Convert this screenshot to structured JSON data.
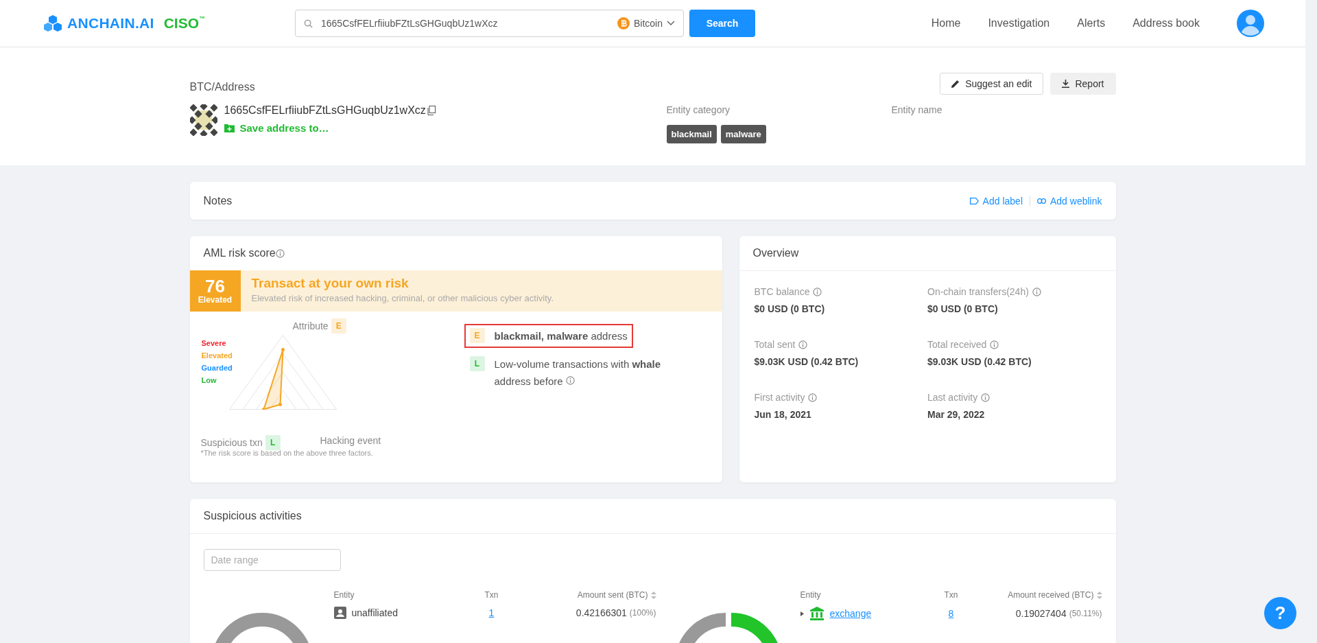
{
  "header": {
    "logo": "ANCHAIN.AI",
    "product": "CISO",
    "trademark": "™",
    "search": {
      "value": "1665CsfFELrfiiubFZtLsGHGuqbUz1wXcz",
      "currency": "Bitcoin",
      "button": "Search"
    },
    "nav": [
      "Home",
      "Investigation",
      "Alerts",
      "Address book"
    ]
  },
  "address": {
    "breadcrumb": "BTC/Address",
    "buttons": [
      {
        "kind": "edit",
        "label": "Suggest an edit"
      },
      {
        "kind": "report",
        "label": "Report"
      }
    ],
    "address": "1665CsfFELrfiiubFZtLsGHGuqbUz1wXcz",
    "save_link": "Save address to…",
    "entity_category_label": "Entity category",
    "tags": [
      "blackmail",
      "malware"
    ],
    "entity_name_label": "Entity name"
  },
  "notes": {
    "title": "Notes",
    "actions": [
      {
        "kind": "label",
        "label": "Add label"
      },
      {
        "kind": "weblink",
        "label": "Add weblink"
      }
    ]
  },
  "aml": {
    "title": "AML risk score",
    "score": "76",
    "score_label": "Elevated",
    "kind": "elevated",
    "headline": "Transact at your own risk",
    "description": "Elevated risk of increased hacking, criminal, or other malicious cyber activity.",
    "radar": {
      "axes": [
        {
          "label": "Attribute",
          "badge": "E",
          "kind": "elevated"
        },
        {
          "label": "Suspicious txn",
          "badge": "L",
          "kind": "low"
        },
        {
          "label": "Hacking event"
        }
      ],
      "levels": [
        {
          "label": "Severe",
          "color": "#f5222d"
        },
        {
          "label": "Elevated",
          "color": "#f5a623"
        },
        {
          "label": "Guarded",
          "color": "#1890ff"
        },
        {
          "label": "Low",
          "color": "#22bb33"
        }
      ]
    },
    "factors": [
      {
        "badge": "E",
        "kind": "elevated",
        "text": "**blackmail, malware** address",
        "highlighted": true,
        "info": false
      },
      {
        "badge": "L",
        "kind": "low",
        "text": "Low-volume transactions with **whale** address before",
        "highlighted": false,
        "info": true
      }
    ],
    "footnote": "*The risk score is based on the above three factors."
  },
  "overview": {
    "title": "Overview",
    "items": [
      {
        "label": "BTC balance",
        "value": "$0 USD (0 BTC)"
      },
      {
        "label": "On-chain transfers(24h)",
        "value": "$0 USD (0 BTC)"
      },
      {
        "label": "Total sent",
        "value": "$9.03K USD (0.42 BTC)"
      },
      {
        "label": "Total received",
        "value": "$9.03K USD (0.42 BTC)"
      },
      {
        "label": "First activity",
        "value": "Jun 18, 2021"
      },
      {
        "label": "Last activity",
        "value": "Mar 29, 2022"
      }
    ]
  },
  "suspicious": {
    "title": "Suspicious activities",
    "date_placeholder": "Date range",
    "tables": [
      {
        "columns": [
          "Entity",
          "Txn",
          "Amount sent (BTC)"
        ],
        "rows": [
          {
            "kind": "person",
            "expandable": false,
            "entity": "unaffiliated",
            "link": false,
            "txn": "1",
            "amount": "0.42166301",
            "share": "(100%)"
          }
        ]
      },
      {
        "columns": [
          "Entity",
          "Txn",
          "Amount received (BTC)"
        ],
        "rows": [
          {
            "kind": "exchange",
            "expandable": true,
            "entity": "exchange",
            "link": true,
            "txn": "8",
            "amount": "0.19027404",
            "share": "(50.11%)"
          }
        ]
      }
    ]
  },
  "help": "?"
}
